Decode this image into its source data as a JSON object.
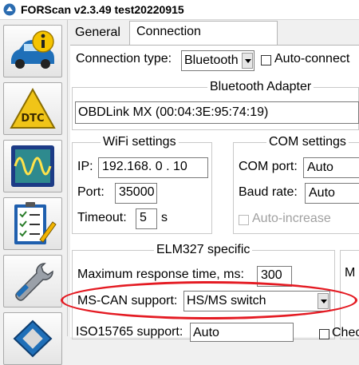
{
  "window": {
    "title": "FORScan v2.3.49 test20220915"
  },
  "sidebar": {
    "items": [
      {
        "name": "vehicle-info",
        "icon": "car-info-icon"
      },
      {
        "name": "dtc",
        "icon": "dtc-warning-icon",
        "label": "DTC"
      },
      {
        "name": "oscilloscope",
        "icon": "oscilloscope-icon"
      },
      {
        "name": "checklist",
        "icon": "checklist-icon"
      },
      {
        "name": "configuration",
        "icon": "wrench-icon"
      },
      {
        "name": "chip",
        "icon": "chip-icon"
      }
    ]
  },
  "tabs": {
    "general": "General",
    "connection": "Connection"
  },
  "connection": {
    "type_label": "Connection type:",
    "type_value": "Bluetooth",
    "auto_connect_label": "Auto-connect"
  },
  "bluetooth": {
    "title": "Bluetooth Adapter",
    "adapter": "OBDLink MX (00:04:3E:95:74:19)"
  },
  "wifi": {
    "title": "WiFi settings",
    "ip_label": "IP:",
    "ip_value": "192.168. 0 . 10",
    "port_label": "Port:",
    "port_value": "35000",
    "timeout_label": "Timeout:",
    "timeout_value": "5",
    "timeout_unit": "s"
  },
  "com": {
    "title": "COM settings",
    "port_label": "COM port:",
    "port_value": "Auto",
    "baud_label": "Baud rate:",
    "baud_value": "Auto",
    "auto_increase_label": "Auto-increase"
  },
  "elm": {
    "title": "ELM327 specific",
    "max_response_label": "Maximum response time, ms:",
    "max_response_value": "300",
    "right_partial": "M",
    "mscan_label": "MS-CAN support:",
    "mscan_value": "HS/MS switch",
    "iso_label": "ISO15765 support:",
    "iso_value": "Auto",
    "check_partial": "Chec"
  },
  "colors": {
    "highlight": "#e41b23",
    "selected_tab_bg": "#ffffff",
    "window_bg": "#f0f0f0"
  }
}
